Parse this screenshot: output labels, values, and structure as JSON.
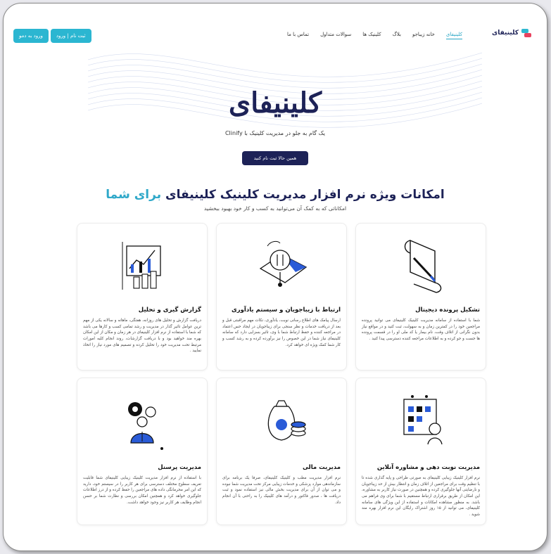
{
  "nav": {
    "logo": "کلینیفای",
    "menu": [
      "کلینیفای",
      "خانه زیباجو",
      "بلاگ",
      "کلینیک ها",
      "سوالات متداول",
      "تماس با ما"
    ],
    "signup_label": "ثبت نام | ورود",
    "demo_label": "ورود به دمو"
  },
  "hero": {
    "title": "کلینیفای",
    "subtitle": "یک گام به جلو در مدیریت کلینیک با Clinify",
    "cta": "همین حالا ثبت نام کنید"
  },
  "features": {
    "title": "امکانات ویژه نرم افزار مدیریت کلینیک کلینیفای",
    "title_highlight": "برای شما",
    "subtitle": "امکاناتی که به کمک آن می‌توانید به کسب و کار خود بهبود ببخشید",
    "cards": [
      {
        "title": "تشکیل پرونده دیجیتال",
        "icon": "document-pen-icon",
        "text": "شما با استفاده از سامانه مدیریت کلینیک کلینیفای می توانید پرونده مراجعین خود را در کمترین زمان و به سهولت، ثبت کنید و در مواقع نیاز بدون نگرانی از اتلاف وقت، نام بیمار یا کد ملی او را در قسمت پرونده ها جست و جو کرده و به اطلاعات مراجعه کننده دسترسی پیدا کنید ."
      },
      {
        "title": "ارتباط با زیباجویان و سیستم یادآوری",
        "icon": "envelope-notification-icon",
        "text": "ارسال پیامک های اطلاع رسانی نوبت، یادآوری، نکات مهم مراقبتی قبل و بعد از دریافت خدمات و نظر سنجی برای زیباجویان در ایجاد حس اعتماد در مراجعه کننده و حفظ ارتباط شما با وی، تاثیر بسزایی دارد که سامانه کلینیفای نیاز شما در این خصوص را نیز برآورده کرده و به رشد کسب و کار شما کمک ویژه ای خواهد کرد."
      },
      {
        "title": "گزارش گیری و تحلیل",
        "icon": "analytics-chart-icon",
        "text": "دریافت گزارش و تحلیل های روزانه، هفتگی، ماهانه و سالانه یکی از مهم ترین عوامل تاثیر گذار در مدیریت و رشد تمامی کسب و کارها می باشد که شما با استفاده از نرم افزار کلینیفای در هر زمان و مکان از این امکان بهره مند خواهید بود و با دریافت گزارشات، روند انجام کلیه امورات مرتبط تحت مدیریت خود را تحلیل کرده و تصمیم های مورد نیاز را اتخاذ نمایید ."
      },
      {
        "title": "مدیریت نوبت دهی و مشاوره آنلاین",
        "icon": "calendar-appointment-icon",
        "text": "نرم افزار کلینیک زیبایی کلینیفای به صورتی طراحی و پایه گذاری شده تا با تنظیم وقت برای مراجعین از اتلاف زمان و انتظار بیش از حد زیباجویان و نارضایتی آنها جلوگیری کرده و همچنین در صورت نیاز کاربر به مشاوره، این امکان از طریق برقراری ارتباط مستقیم با شما برای وی فراهم می باشد. به منظور مشاهده امکانات و استفاده از این ویژگی های سامانه کلینیفای، می توانید از ۱۵ روز اشتراک رایگان این نرم افزار بهره مند شوید ."
      },
      {
        "title": "مدیریت مالی",
        "icon": "money-bag-icon",
        "text": "نرم افزار مدیریت مطب و کلینیک کلینیفای، صرفا یک برنامه برای سازماندهی موارد پزشکی و خدمات زیبایی مرکز تحت مدیریت شما نبوده و می توان از آن برای مدیریت بخش مالی نیز استفاده نمود و ثبت دریافت ها ، صدور فاکتور و درآمد های کلینیک را به راحتی با آن انجام داد."
      },
      {
        "title": "مدیریت پرسنل",
        "icon": "staff-gear-icon",
        "text": "با استفاده از نرم افزار مدیریت کلینیک زیبایی کلینیفای شما قابلیت تعریف سطوح مختلف دسترسی برای هر کاربر را در سیستم خود، دارید که این امر محرمانگی داده های مراجعین را حفظ کرده و از درز اطلاعات جلوگیری خواهد کرد و همچنین امکان بررسی و نظارت شما بر حسن انجام وظایف هر کاربر نیز وجود خواهد داشت."
      }
    ]
  }
}
